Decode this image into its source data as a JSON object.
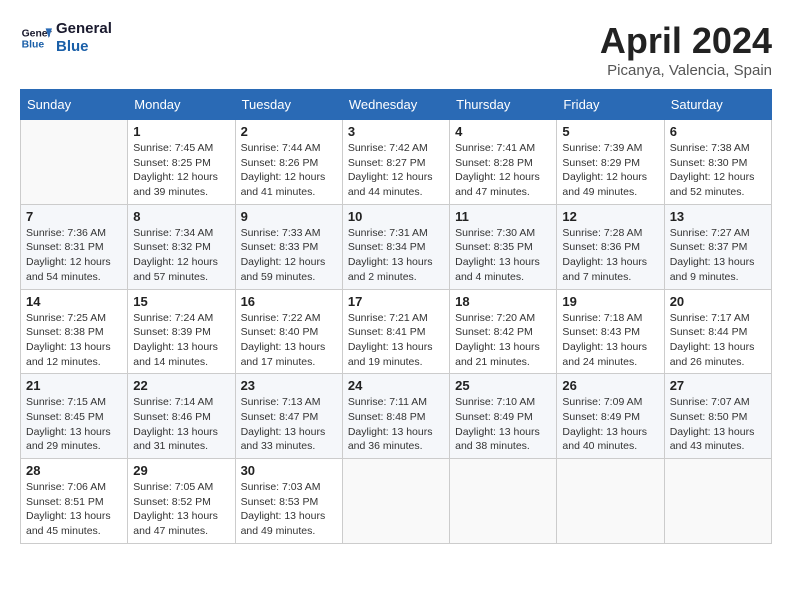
{
  "header": {
    "logo_line1": "General",
    "logo_line2": "Blue",
    "month": "April 2024",
    "location": "Picanya, Valencia, Spain"
  },
  "days_of_week": [
    "Sunday",
    "Monday",
    "Tuesday",
    "Wednesday",
    "Thursday",
    "Friday",
    "Saturday"
  ],
  "weeks": [
    [
      {
        "day": "",
        "detail": ""
      },
      {
        "day": "1",
        "detail": "Sunrise: 7:45 AM\nSunset: 8:25 PM\nDaylight: 12 hours\nand 39 minutes."
      },
      {
        "day": "2",
        "detail": "Sunrise: 7:44 AM\nSunset: 8:26 PM\nDaylight: 12 hours\nand 41 minutes."
      },
      {
        "day": "3",
        "detail": "Sunrise: 7:42 AM\nSunset: 8:27 PM\nDaylight: 12 hours\nand 44 minutes."
      },
      {
        "day": "4",
        "detail": "Sunrise: 7:41 AM\nSunset: 8:28 PM\nDaylight: 12 hours\nand 47 minutes."
      },
      {
        "day": "5",
        "detail": "Sunrise: 7:39 AM\nSunset: 8:29 PM\nDaylight: 12 hours\nand 49 minutes."
      },
      {
        "day": "6",
        "detail": "Sunrise: 7:38 AM\nSunset: 8:30 PM\nDaylight: 12 hours\nand 52 minutes."
      }
    ],
    [
      {
        "day": "7",
        "detail": "Sunrise: 7:36 AM\nSunset: 8:31 PM\nDaylight: 12 hours\nand 54 minutes."
      },
      {
        "day": "8",
        "detail": "Sunrise: 7:34 AM\nSunset: 8:32 PM\nDaylight: 12 hours\nand 57 minutes."
      },
      {
        "day": "9",
        "detail": "Sunrise: 7:33 AM\nSunset: 8:33 PM\nDaylight: 12 hours\nand 59 minutes."
      },
      {
        "day": "10",
        "detail": "Sunrise: 7:31 AM\nSunset: 8:34 PM\nDaylight: 13 hours\nand 2 minutes."
      },
      {
        "day": "11",
        "detail": "Sunrise: 7:30 AM\nSunset: 8:35 PM\nDaylight: 13 hours\nand 4 minutes."
      },
      {
        "day": "12",
        "detail": "Sunrise: 7:28 AM\nSunset: 8:36 PM\nDaylight: 13 hours\nand 7 minutes."
      },
      {
        "day": "13",
        "detail": "Sunrise: 7:27 AM\nSunset: 8:37 PM\nDaylight: 13 hours\nand 9 minutes."
      }
    ],
    [
      {
        "day": "14",
        "detail": "Sunrise: 7:25 AM\nSunset: 8:38 PM\nDaylight: 13 hours\nand 12 minutes."
      },
      {
        "day": "15",
        "detail": "Sunrise: 7:24 AM\nSunset: 8:39 PM\nDaylight: 13 hours\nand 14 minutes."
      },
      {
        "day": "16",
        "detail": "Sunrise: 7:22 AM\nSunset: 8:40 PM\nDaylight: 13 hours\nand 17 minutes."
      },
      {
        "day": "17",
        "detail": "Sunrise: 7:21 AM\nSunset: 8:41 PM\nDaylight: 13 hours\nand 19 minutes."
      },
      {
        "day": "18",
        "detail": "Sunrise: 7:20 AM\nSunset: 8:42 PM\nDaylight: 13 hours\nand 21 minutes."
      },
      {
        "day": "19",
        "detail": "Sunrise: 7:18 AM\nSunset: 8:43 PM\nDaylight: 13 hours\nand 24 minutes."
      },
      {
        "day": "20",
        "detail": "Sunrise: 7:17 AM\nSunset: 8:44 PM\nDaylight: 13 hours\nand 26 minutes."
      }
    ],
    [
      {
        "day": "21",
        "detail": "Sunrise: 7:15 AM\nSunset: 8:45 PM\nDaylight: 13 hours\nand 29 minutes."
      },
      {
        "day": "22",
        "detail": "Sunrise: 7:14 AM\nSunset: 8:46 PM\nDaylight: 13 hours\nand 31 minutes."
      },
      {
        "day": "23",
        "detail": "Sunrise: 7:13 AM\nSunset: 8:47 PM\nDaylight: 13 hours\nand 33 minutes."
      },
      {
        "day": "24",
        "detail": "Sunrise: 7:11 AM\nSunset: 8:48 PM\nDaylight: 13 hours\nand 36 minutes."
      },
      {
        "day": "25",
        "detail": "Sunrise: 7:10 AM\nSunset: 8:49 PM\nDaylight: 13 hours\nand 38 minutes."
      },
      {
        "day": "26",
        "detail": "Sunrise: 7:09 AM\nSunset: 8:49 PM\nDaylight: 13 hours\nand 40 minutes."
      },
      {
        "day": "27",
        "detail": "Sunrise: 7:07 AM\nSunset: 8:50 PM\nDaylight: 13 hours\nand 43 minutes."
      }
    ],
    [
      {
        "day": "28",
        "detail": "Sunrise: 7:06 AM\nSunset: 8:51 PM\nDaylight: 13 hours\nand 45 minutes."
      },
      {
        "day": "29",
        "detail": "Sunrise: 7:05 AM\nSunset: 8:52 PM\nDaylight: 13 hours\nand 47 minutes."
      },
      {
        "day": "30",
        "detail": "Sunrise: 7:03 AM\nSunset: 8:53 PM\nDaylight: 13 hours\nand 49 minutes."
      },
      {
        "day": "",
        "detail": ""
      },
      {
        "day": "",
        "detail": ""
      },
      {
        "day": "",
        "detail": ""
      },
      {
        "day": "",
        "detail": ""
      }
    ]
  ]
}
